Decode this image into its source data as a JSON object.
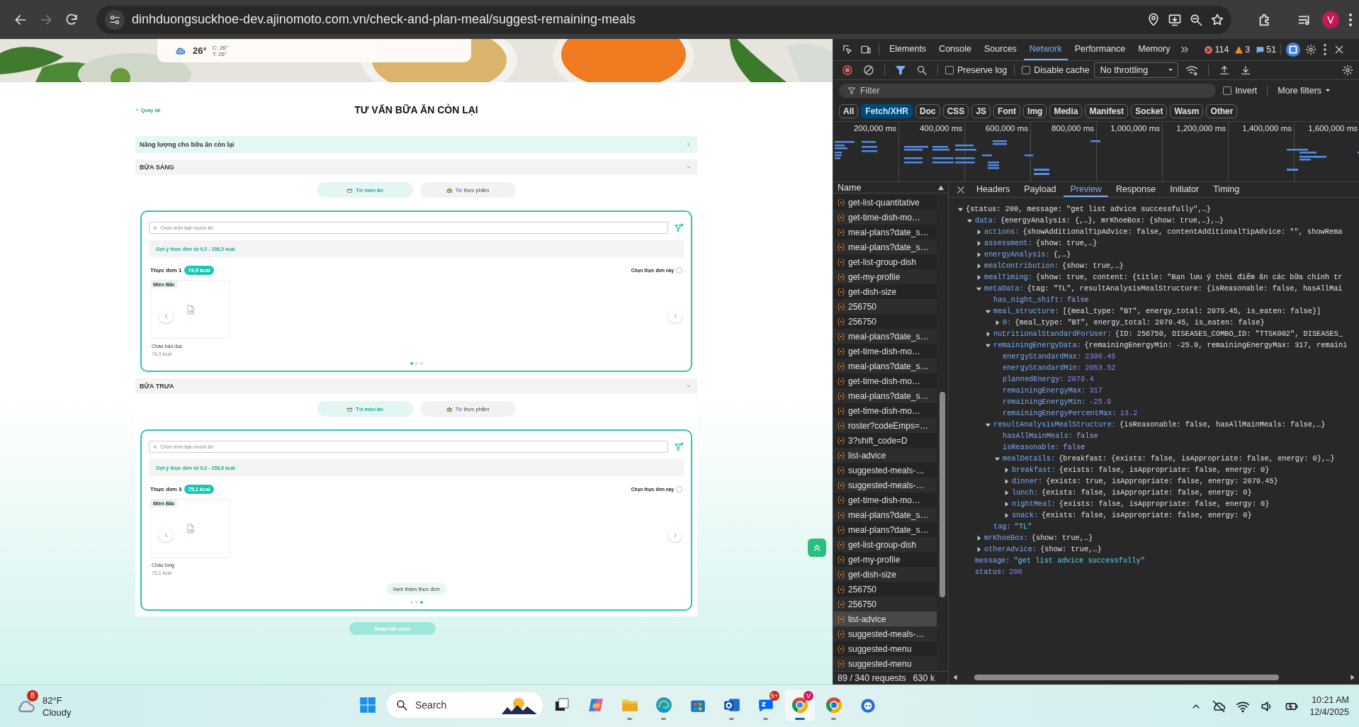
{
  "browser": {
    "nav": [
      {
        "kind": "back",
        "disabled": false
      },
      {
        "kind": "forward",
        "disabled": true
      },
      {
        "kind": "reload",
        "disabled": false
      }
    ],
    "url": "dinhduongsuckhoe-dev.ajinomoto.com.vn/check-and-plan-meal/suggest-remaining-meals",
    "profile_initial": "V"
  },
  "page": {
    "weather": {
      "temp": "26°",
      "high": "C: 26°",
      "low": "T: 26°"
    },
    "back_link": "Quay lại",
    "title": "TƯ VẤN BỮA ĂN CÒN LẠI",
    "energy_section": {
      "label": "Năng lượng cho bữa ăn còn lại",
      "expanded": false
    },
    "meals": [
      {
        "title": "BỮA SÁNG",
        "expanded": true,
        "tabs": [
          {
            "label": "Từ món ăn",
            "selected": true
          },
          {
            "label": "Từ thực phẩm",
            "selected": false
          }
        ],
        "search_placeholder": "Chọn món bạn muốn ăn",
        "suggestion": "Gợi ý thực đơn từ 0,0 - 158,5 kcal",
        "menu": {
          "label": "Thực đơn 1",
          "kcal": "74,9 kcal",
          "select_label": "Chọn thực đơn này",
          "selected": false
        },
        "dishes": [
          {
            "region": "Miền Bắc",
            "name": "Cháo bầu dục",
            "kcal": "74,9 kcal"
          }
        ],
        "dots": [
          {
            "selected": true
          },
          {
            "selected": false
          },
          {
            "selected": false
          }
        ]
      },
      {
        "title": "BỮA TRƯA",
        "expanded": true,
        "tabs": [
          {
            "label": "Từ món ăn",
            "selected": true
          },
          {
            "label": "Từ thực phẩm",
            "selected": false
          }
        ],
        "search_placeholder": "Chọn món bạn muốn ăn",
        "suggestion": "Gợi ý thực đơn từ 0,0 - 158,5 kcal",
        "menu": {
          "label": "Thực đơn 3",
          "kcal": "75,1 kcal",
          "select_label": "Chọn thực đơn này",
          "selected": false
        },
        "dishes": [
          {
            "region": "Miền Bắc",
            "name": "Cháo lòng",
            "kcal": "75,1 kcal"
          }
        ],
        "more_button": "Xem thêm thực đơn",
        "dots": [
          {
            "selected": false
          },
          {
            "selected": false
          },
          {
            "selected": true
          }
        ]
      }
    ],
    "finish_button": {
      "label": "Hoàn tất chọn",
      "disabled": true
    }
  },
  "devtools": {
    "tabs": [
      {
        "label": "Elements",
        "selected": false
      },
      {
        "label": "Console",
        "selected": false
      },
      {
        "label": "Sources",
        "selected": false
      },
      {
        "label": "Network",
        "selected": true
      },
      {
        "label": "Performance",
        "selected": false
      },
      {
        "label": "Memory",
        "selected": false
      }
    ],
    "errors": "114",
    "warnings": "3",
    "messages": "51",
    "preserve_log": {
      "label": "Preserve log",
      "checked": false
    },
    "disable_cache": {
      "label": "Disable cache",
      "checked": false
    },
    "throttling": "No throttling",
    "filter_placeholder": "Filter",
    "invert": {
      "label": "Invert",
      "checked": false
    },
    "more_filters": "More filters",
    "type_filters": [
      {
        "label": "All",
        "selected": false
      },
      {
        "label": "Fetch/XHR",
        "selected": true
      },
      {
        "label": "Doc",
        "selected": false
      },
      {
        "label": "CSS",
        "selected": false
      },
      {
        "label": "JS",
        "selected": false
      },
      {
        "label": "Font",
        "selected": false
      },
      {
        "label": "Img",
        "selected": false
      },
      {
        "label": "Media",
        "selected": false
      },
      {
        "label": "Manifest",
        "selected": false
      },
      {
        "label": "Socket",
        "selected": false
      },
      {
        "label": "Wasm",
        "selected": false
      },
      {
        "label": "Other",
        "selected": false
      }
    ],
    "timeline_ticks": [
      "200,000 ms",
      "400,000 ms",
      "600,000 ms",
      "800,000 ms",
      "1,000,000 ms",
      "1,200,000 ms",
      "1,400,000 ms",
      "1,600,000 ms"
    ],
    "name_header": "Name",
    "requests": [
      {
        "name": "get-list-quantitative",
        "selected": false
      },
      {
        "name": "get-time-dish-mo…",
        "selected": false
      },
      {
        "name": "meal-plans?date_s…",
        "selected": false
      },
      {
        "name": "meal-plans?date_s…",
        "selected": false
      },
      {
        "name": "get-list-group-dish",
        "selected": false
      },
      {
        "name": "get-my-profile",
        "selected": false
      },
      {
        "name": "get-dish-size",
        "selected": false
      },
      {
        "name": "256750",
        "selected": false
      },
      {
        "name": "256750",
        "selected": false
      },
      {
        "name": "meal-plans?date_s…",
        "selected": false
      },
      {
        "name": "get-time-dish-mo…",
        "selected": false
      },
      {
        "name": "meal-plans?date_s…",
        "selected": false
      },
      {
        "name": "get-time-dish-mo…",
        "selected": false
      },
      {
        "name": "meal-plans?date_s…",
        "selected": false
      },
      {
        "name": "get-time-dish-mo…",
        "selected": false
      },
      {
        "name": "roster?codeEmps=…",
        "selected": false
      },
      {
        "name": "3?shift_code=D",
        "selected": false
      },
      {
        "name": "list-advice",
        "selected": false
      },
      {
        "name": "suggested-meals-…",
        "selected": false
      },
      {
        "name": "suggested-meals-…",
        "selected": false
      },
      {
        "name": "get-time-dish-mo…",
        "selected": false
      },
      {
        "name": "meal-plans?date_s…",
        "selected": false
      },
      {
        "name": "meal-plans?date_s…",
        "selected": false
      },
      {
        "name": "get-list-group-dish",
        "selected": false
      },
      {
        "name": "get-my-profile",
        "selected": false
      },
      {
        "name": "get-dish-size",
        "selected": false
      },
      {
        "name": "256750",
        "selected": false
      },
      {
        "name": "256750",
        "selected": false
      },
      {
        "name": "list-advice",
        "selected": true
      },
      {
        "name": "suggested-meals-…",
        "selected": false
      },
      {
        "name": "suggested-menu",
        "selected": false
      },
      {
        "name": "suggested-menu",
        "selected": false
      }
    ],
    "detail_tabs": [
      {
        "label": "Headers",
        "selected": false
      },
      {
        "label": "Payload",
        "selected": false
      },
      {
        "label": "Preview",
        "selected": true
      },
      {
        "label": "Response",
        "selected": false
      },
      {
        "label": "Initiator",
        "selected": false
      },
      {
        "label": "Timing",
        "selected": false
      }
    ],
    "preview": [
      {
        "value": "{status: 200, message: \"get list advice successfully\",…}",
        "expanded": true,
        "children": [
          {
            "key": "data:",
            "value": "{energyAnalysis: {,…}, mrKhoeBox: {show: true,…},…}",
            "expanded": true,
            "children": [
              {
                "key": "actions:",
                "value": "{showAdditionalTipAdvice: false, contentAdditionalTipAdvice: \"\", showRema",
                "expanded": false
              },
              {
                "key": "assessment:",
                "value": "{show: true,…}",
                "expanded": false
              },
              {
                "key": "energyAnalysis:",
                "value": "{,…}",
                "expanded": false
              },
              {
                "key": "mealContribution:",
                "value": "{show: true,…}",
                "expanded": false
              },
              {
                "key": "mealTiming:",
                "value": "{show: true, content: {title: \"Bạn lưu ý thời điểm ăn các bữa chính tr",
                "expanded": false
              },
              {
                "key": "metaData:",
                "value": "{tag: \"TL\", resultAnalysisMealStructure: {isReasonable: false, hasAllMai",
                "expanded": true,
                "children": [
                  {
                    "key": "has_night_shift:",
                    "value": "false",
                    "kind": "boolean"
                  },
                  {
                    "key": "meal_structure:",
                    "value": "[{meal_type: \"BT\", energy_total: 2079.45, is_eaten: false}]",
                    "expanded": true,
                    "children": [
                      {
                        "key": "0:",
                        "value": "{meal_type: \"BT\", energy_total: 2079.45, is_eaten: false}",
                        "expanded": false
                      }
                    ]
                  },
                  {
                    "key": "nutritionalStandardForUser:",
                    "value": "{ID: 256750, DISEASES_COMBO_ID: \"TTSK002\", DISEASES_",
                    "expanded": false
                  },
                  {
                    "key": "remainingEnergyData:",
                    "value": "{remainingEnergyMin: -25.9, remainingEnergyMax: 317, remaini",
                    "expanded": true,
                    "children": [
                      {
                        "key": "energyStandardMax:",
                        "value": "2396.45",
                        "kind": "number"
                      },
                      {
                        "key": "energyStandardMin:",
                        "value": "2053.52",
                        "kind": "number"
                      },
                      {
                        "key": "plannedEnergy:",
                        "value": "2079.4",
                        "kind": "number"
                      },
                      {
                        "key": "remainingEnergyMax:",
                        "value": "317",
                        "kind": "number"
                      },
                      {
                        "key": "remainingEnergyMin:",
                        "value": "-25.9",
                        "kind": "number"
                      },
                      {
                        "key": "remainingEnergyPercentMax:",
                        "value": "13.2",
                        "kind": "number"
                      }
                    ]
                  },
                  {
                    "key": "resultAnalysisMealStructure:",
                    "value": "{isReasonable: false, hasAllMainMeals: false,…}",
                    "expanded": true,
                    "children": [
                      {
                        "key": "hasAllMainMeals:",
                        "value": "false",
                        "kind": "boolean"
                      },
                      {
                        "key": "isReasonable:",
                        "value": "false",
                        "kind": "boolean"
                      },
                      {
                        "key": "mealDetails:",
                        "value": "{breakfast: {exists: false, isAppropriate: false, energy: 0},…}",
                        "expanded": true,
                        "children": [
                          {
                            "key": "breakfast:",
                            "value": "{exists: false, isAppropriate: false, energy: 0}",
                            "expanded": false
                          },
                          {
                            "key": "dinner:",
                            "value": "{exists: true, isAppropriate: false, energy: 2079.45}",
                            "expanded": false
                          },
                          {
                            "key": "lunch:",
                            "value": "{exists: false, isAppropriate: false, energy: 0}",
                            "expanded": false
                          },
                          {
                            "key": "nightMeal:",
                            "value": "{exists: false, isAppropriate: false, energy: 0}",
                            "expanded": false
                          },
                          {
                            "key": "snack:",
                            "value": "{exists: false, isAppropriate: false, energy: 0}",
                            "expanded": false
                          }
                        ]
                      }
                    ]
                  },
                  {
                    "key": "tag:",
                    "value": "\"TL\"",
                    "kind": "string"
                  }
                ]
              },
              {
                "key": "mrKhoeBox:",
                "value": "{show: true,…}",
                "expanded": false
              },
              {
                "key": "otherAdvice:",
                "value": "{show: true,…}",
                "expanded": false
              }
            ]
          },
          {
            "key": "message:",
            "value": "\"get list advice successfully\"",
            "kind": "string"
          },
          {
            "key": "status:",
            "value": "200",
            "kind": "number"
          }
        ]
      }
    ],
    "request_count": "89 / 340 requests",
    "transferred": "630 k"
  },
  "taskbar": {
    "weather": {
      "badge": "8",
      "temp": "82°F",
      "condition": "Cloudy"
    },
    "search_placeholder": "Search",
    "apps": [
      {
        "kind": "task-view",
        "running": false,
        "active": false
      },
      {
        "kind": "copilot",
        "running": false,
        "active": false
      },
      {
        "kind": "folder",
        "running": true,
        "active": false
      },
      {
        "kind": "edge",
        "running": true,
        "active": false
      },
      {
        "kind": "store",
        "running": false,
        "active": false
      },
      {
        "kind": "outlook",
        "running": true,
        "active": false
      },
      {
        "kind": "zalo",
        "running": true,
        "active": false,
        "badge": "5+"
      },
      {
        "kind": "chrome",
        "running": true,
        "active": true,
        "badge": "V"
      },
      {
        "kind": "chrome-alt",
        "running": true,
        "active": false
      },
      {
        "kind": "bot",
        "running": false,
        "active": false
      }
    ],
    "time": "10:21 AM",
    "date": "12/4/2025"
  }
}
